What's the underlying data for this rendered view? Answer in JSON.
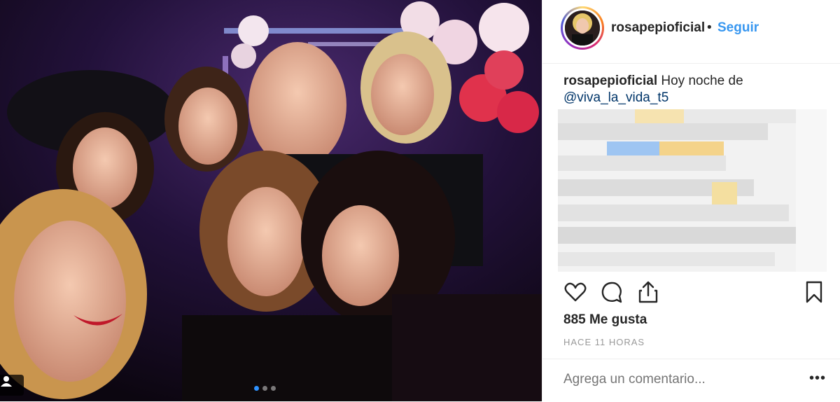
{
  "post": {
    "username": "rosapepioficial",
    "separator": "•",
    "follow_label": "Seguir",
    "caption_user": "rosapepioficial",
    "caption_text": "Hoy noche de",
    "caption_mention": "@viva_la_vida_t5",
    "likes": "885 Me gusta",
    "time_ago": "HACE 11 HORAS",
    "comment_placeholder": "Agrega un comentario...",
    "more_label": "•••",
    "carousel": {
      "count": 3,
      "active_index": 0
    }
  },
  "icons": {
    "like": "heart-icon",
    "comment": "comment-icon",
    "share": "share-icon",
    "save": "bookmark-icon",
    "tag": "user-tag-icon"
  },
  "colors": {
    "link": "#3897f0",
    "text": "#262626",
    "muted": "#999999",
    "border": "#efefef"
  }
}
